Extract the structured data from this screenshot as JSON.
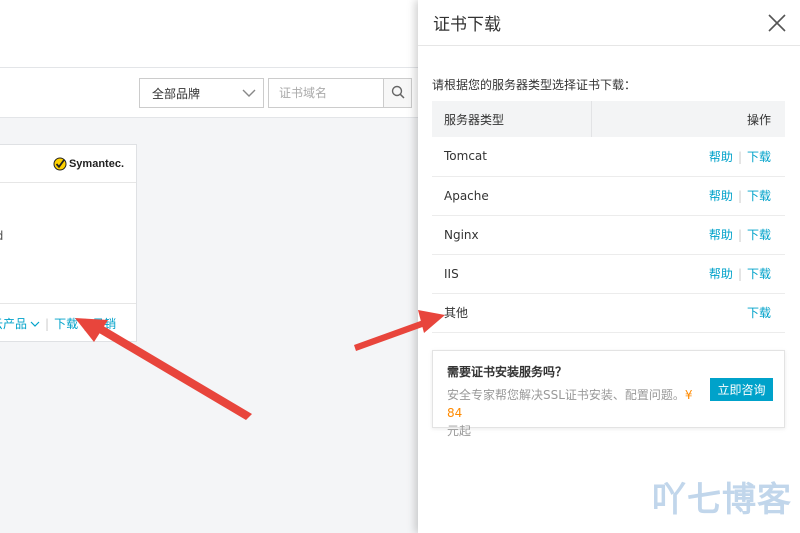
{
  "toolbar": {
    "brand_select_value": "全部品牌",
    "search_placeholder": "证书域名"
  },
  "cert_card": {
    "brand_logo": "Symantec.",
    "body_text_fragment": "td",
    "footer": {
      "product_label": "云产品",
      "download_label": "下载",
      "revoke_label": "吊销"
    }
  },
  "drawer": {
    "title": "证书下载",
    "instruction": "请根据您的服务器类型选择证书下载：",
    "table": {
      "headers": [
        "服务器类型",
        "操作"
      ],
      "rows": [
        {
          "server": "Tomcat",
          "help": "帮助",
          "download": "下载"
        },
        {
          "server": "Apache",
          "help": "帮助",
          "download": "下载"
        },
        {
          "server": "Nginx",
          "help": "帮助",
          "download": "下载"
        },
        {
          "server": "IIS",
          "help": "帮助",
          "download": "下载"
        },
        {
          "server": "其他",
          "help": "",
          "download": "下载"
        }
      ]
    },
    "promo": {
      "title": "需要证书安装服务吗？",
      "desc_prefix": "安全专家帮您解决SSL证书安装、配置问题。",
      "price": "¥ 84",
      "desc_suffix": "元起",
      "button": "立即咨询"
    }
  },
  "watermark": "吖七博客",
  "icons": {
    "close": "close-icon",
    "search": "search-icon",
    "chevron": "chevron-down-icon",
    "symantec_check": "symantec-check-icon"
  },
  "colors": {
    "link": "#00a2ca",
    "price": "#ff8a00",
    "arrow": "#e8453c",
    "button": "#00a2ca"
  }
}
